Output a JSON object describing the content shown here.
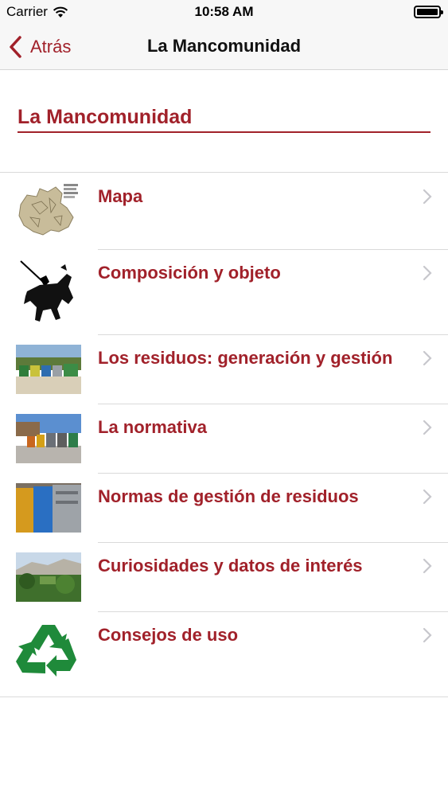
{
  "status": {
    "carrier": "Carrier",
    "time": "10:58 AM"
  },
  "nav": {
    "back_label": "Atrás",
    "title": "La Mancomunidad"
  },
  "section": {
    "title": "La Mancomunidad"
  },
  "items": [
    {
      "label": "Mapa",
      "icon": "map-thumbnail"
    },
    {
      "label": "Composición y objeto",
      "icon": "knight-silhouette"
    },
    {
      "label": "Los residuos: generación y gestión",
      "icon": "containers-photo"
    },
    {
      "label": "La normativa",
      "icon": "street-containers-photo"
    },
    {
      "label": "Normas de gestión de residuos",
      "icon": "bins-photo"
    },
    {
      "label": "Curiosidades y datos de interés",
      "icon": "landscape-photo"
    },
    {
      "label": "Consejos de uso",
      "icon": "recycle-icon"
    }
  ],
  "colors": {
    "accent": "#a1212a",
    "bar": "#f7f7f7",
    "separator": "#dadada"
  }
}
